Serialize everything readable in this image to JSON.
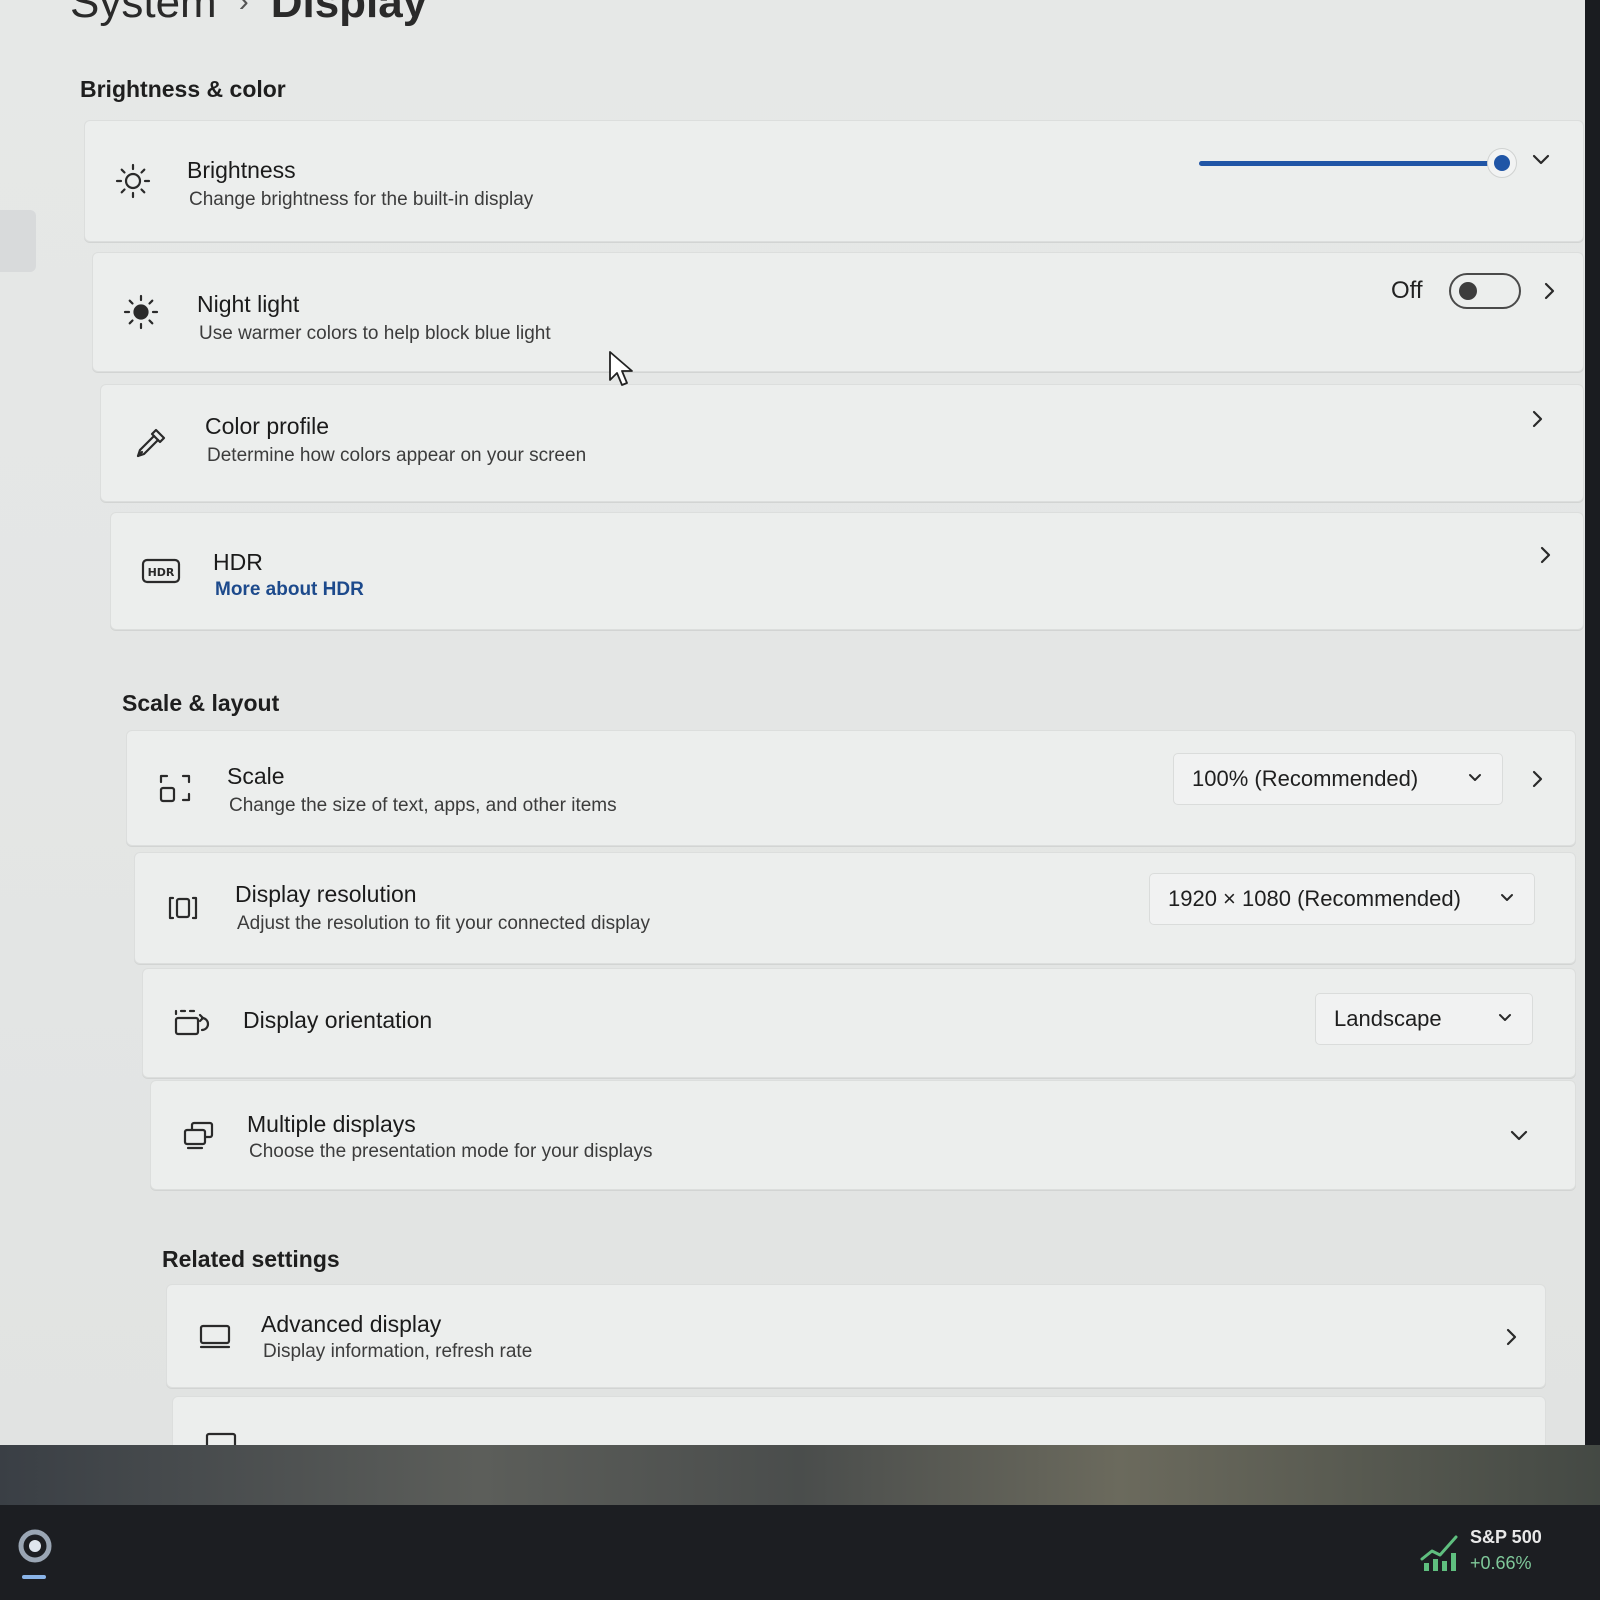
{
  "breadcrumb": {
    "parent": "System",
    "separator": "›",
    "current": "Display"
  },
  "sections": {
    "brightness_color": "Brightness & color",
    "scale_layout": "Scale & layout",
    "related": "Related settings"
  },
  "brightness": {
    "title": "Brightness",
    "subtitle": "Change brightness for the built-in display",
    "level": 1.0
  },
  "night_light": {
    "title": "Night light",
    "subtitle": "Use warmer colors to help block blue light",
    "state": "Off"
  },
  "color_profile": {
    "title": "Color profile",
    "subtitle": "Determine how colors appear on your screen"
  },
  "hdr": {
    "title": "HDR",
    "link": "More about HDR",
    "icon_text": "HDR"
  },
  "scale": {
    "title": "Scale",
    "subtitle": "Change the size of text, apps, and other items",
    "value": "100% (Recommended)"
  },
  "resolution": {
    "title": "Display resolution",
    "subtitle": "Adjust the resolution to fit your connected display",
    "value": "1920 × 1080 (Recommended)"
  },
  "orientation": {
    "title": "Display orientation",
    "value": "Landscape"
  },
  "multiple": {
    "title": "Multiple displays",
    "subtitle": "Choose the presentation mode for your displays"
  },
  "advanced": {
    "title": "Advanced display",
    "subtitle": "Display information, refresh rate"
  },
  "taskbar": {
    "widget_name": "S&P 500",
    "widget_change": "+0.66%"
  },
  "colors": {
    "accent": "#2055a6",
    "link": "#1d4a8c",
    "stock_up": "#7fc99a"
  }
}
